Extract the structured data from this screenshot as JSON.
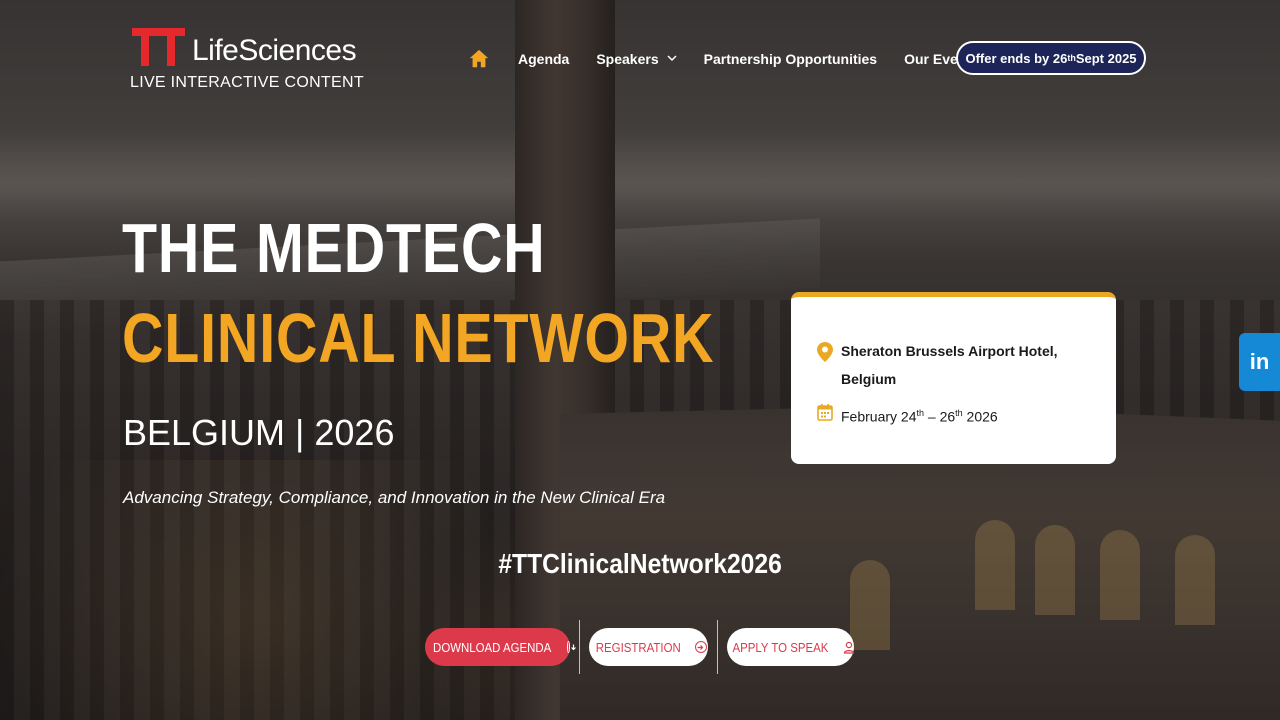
{
  "brand": {
    "name": "LifeSciences",
    "tagline": "LIVE INTERACTIVE CONTENT"
  },
  "nav": {
    "items": [
      {
        "label": "Agenda"
      },
      {
        "label": "Speakers"
      },
      {
        "label": "Partnership Opportunities"
      },
      {
        "label": "Our Events"
      }
    ],
    "offer": {
      "prefix": "Offer ends by 26",
      "sup": "th",
      "suffix": "Sept 2025"
    }
  },
  "hero": {
    "title_line1": "THE MEDTECH",
    "title_line2": "CLINICAL NETWORK",
    "subtitle": "BELGIUM | 2026",
    "tagline": "Advancing Strategy, Compliance, and Innovation in the New Clinical Era",
    "hashtag": "#TTClinicalNetwork2026"
  },
  "info_card": {
    "venue_line1": "Sheraton Brussels Airport Hotel,",
    "venue_line2": "Belgium",
    "date_start": "February 24",
    "date_start_sup": "th",
    "date_sep": " – 26",
    "date_end_sup": "th",
    "date_year": " 2026"
  },
  "cta": {
    "download": "DOWNLOAD AGENDA",
    "register": "REGISTRATION",
    "speak": "APPLY TO SPEAK"
  },
  "social": {
    "linkedin": "in"
  },
  "colors": {
    "accent_orange": "#f2a623",
    "brand_red": "#e4282c",
    "cta_red": "#dc3a4b",
    "offer_navy": "#1d2457",
    "linkedin_blue": "#1689d6"
  }
}
